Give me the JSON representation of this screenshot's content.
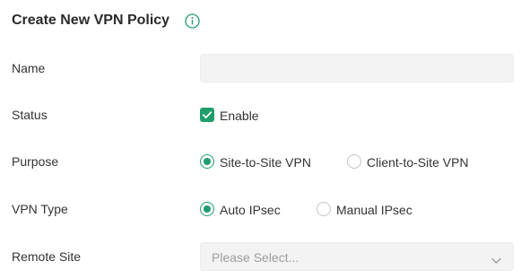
{
  "form": {
    "title": "Create New VPN Policy",
    "info_icon": "info-circle-icon",
    "accent_color": "#1f9d6a",
    "fields": {
      "name": {
        "label": "Name",
        "value": "",
        "placeholder": ""
      },
      "status": {
        "label": "Status",
        "checkbox_label": "Enable",
        "checked": true
      },
      "purpose": {
        "label": "Purpose",
        "options": [
          "Site-to-Site VPN",
          "Client-to-Site VPN"
        ],
        "selected": "Site-to-Site VPN"
      },
      "vpn_type": {
        "label": "VPN Type",
        "options": [
          "Auto IPsec",
          "Manual IPsec"
        ],
        "selected": "Auto IPsec"
      },
      "remote_site": {
        "label": "Remote Site",
        "placeholder": "Please Select...",
        "icon": "chevron-down-icon"
      }
    }
  }
}
